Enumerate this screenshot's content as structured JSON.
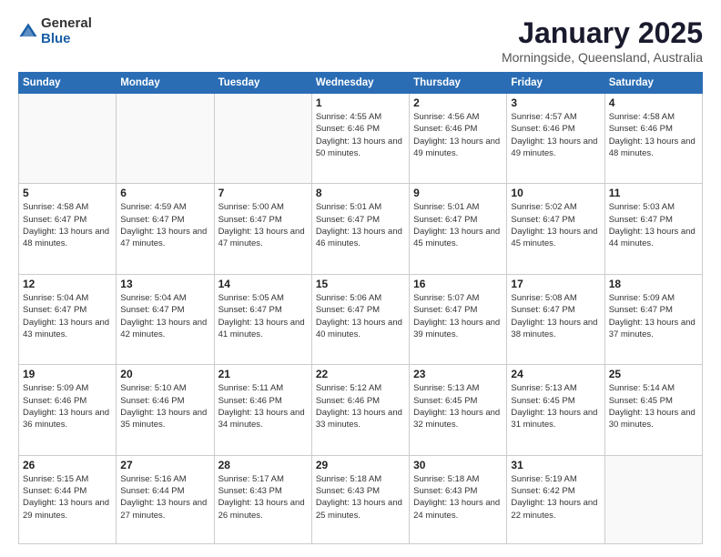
{
  "logo": {
    "general": "General",
    "blue": "Blue"
  },
  "title": "January 2025",
  "subtitle": "Morningside, Queensland, Australia",
  "days_of_week": [
    "Sunday",
    "Monday",
    "Tuesday",
    "Wednesday",
    "Thursday",
    "Friday",
    "Saturday"
  ],
  "weeks": [
    [
      {
        "day": "",
        "info": ""
      },
      {
        "day": "",
        "info": ""
      },
      {
        "day": "",
        "info": ""
      },
      {
        "day": "1",
        "info": "Sunrise: 4:55 AM\nSunset: 6:46 PM\nDaylight: 13 hours\nand 50 minutes."
      },
      {
        "day": "2",
        "info": "Sunrise: 4:56 AM\nSunset: 6:46 PM\nDaylight: 13 hours\nand 49 minutes."
      },
      {
        "day": "3",
        "info": "Sunrise: 4:57 AM\nSunset: 6:46 PM\nDaylight: 13 hours\nand 49 minutes."
      },
      {
        "day": "4",
        "info": "Sunrise: 4:58 AM\nSunset: 6:46 PM\nDaylight: 13 hours\nand 48 minutes."
      }
    ],
    [
      {
        "day": "5",
        "info": "Sunrise: 4:58 AM\nSunset: 6:47 PM\nDaylight: 13 hours\nand 48 minutes."
      },
      {
        "day": "6",
        "info": "Sunrise: 4:59 AM\nSunset: 6:47 PM\nDaylight: 13 hours\nand 47 minutes."
      },
      {
        "day": "7",
        "info": "Sunrise: 5:00 AM\nSunset: 6:47 PM\nDaylight: 13 hours\nand 47 minutes."
      },
      {
        "day": "8",
        "info": "Sunrise: 5:01 AM\nSunset: 6:47 PM\nDaylight: 13 hours\nand 46 minutes."
      },
      {
        "day": "9",
        "info": "Sunrise: 5:01 AM\nSunset: 6:47 PM\nDaylight: 13 hours\nand 45 minutes."
      },
      {
        "day": "10",
        "info": "Sunrise: 5:02 AM\nSunset: 6:47 PM\nDaylight: 13 hours\nand 45 minutes."
      },
      {
        "day": "11",
        "info": "Sunrise: 5:03 AM\nSunset: 6:47 PM\nDaylight: 13 hours\nand 44 minutes."
      }
    ],
    [
      {
        "day": "12",
        "info": "Sunrise: 5:04 AM\nSunset: 6:47 PM\nDaylight: 13 hours\nand 43 minutes."
      },
      {
        "day": "13",
        "info": "Sunrise: 5:04 AM\nSunset: 6:47 PM\nDaylight: 13 hours\nand 42 minutes."
      },
      {
        "day": "14",
        "info": "Sunrise: 5:05 AM\nSunset: 6:47 PM\nDaylight: 13 hours\nand 41 minutes."
      },
      {
        "day": "15",
        "info": "Sunrise: 5:06 AM\nSunset: 6:47 PM\nDaylight: 13 hours\nand 40 minutes."
      },
      {
        "day": "16",
        "info": "Sunrise: 5:07 AM\nSunset: 6:47 PM\nDaylight: 13 hours\nand 39 minutes."
      },
      {
        "day": "17",
        "info": "Sunrise: 5:08 AM\nSunset: 6:47 PM\nDaylight: 13 hours\nand 38 minutes."
      },
      {
        "day": "18",
        "info": "Sunrise: 5:09 AM\nSunset: 6:47 PM\nDaylight: 13 hours\nand 37 minutes."
      }
    ],
    [
      {
        "day": "19",
        "info": "Sunrise: 5:09 AM\nSunset: 6:46 PM\nDaylight: 13 hours\nand 36 minutes."
      },
      {
        "day": "20",
        "info": "Sunrise: 5:10 AM\nSunset: 6:46 PM\nDaylight: 13 hours\nand 35 minutes."
      },
      {
        "day": "21",
        "info": "Sunrise: 5:11 AM\nSunset: 6:46 PM\nDaylight: 13 hours\nand 34 minutes."
      },
      {
        "day": "22",
        "info": "Sunrise: 5:12 AM\nSunset: 6:46 PM\nDaylight: 13 hours\nand 33 minutes."
      },
      {
        "day": "23",
        "info": "Sunrise: 5:13 AM\nSunset: 6:45 PM\nDaylight: 13 hours\nand 32 minutes."
      },
      {
        "day": "24",
        "info": "Sunrise: 5:13 AM\nSunset: 6:45 PM\nDaylight: 13 hours\nand 31 minutes."
      },
      {
        "day": "25",
        "info": "Sunrise: 5:14 AM\nSunset: 6:45 PM\nDaylight: 13 hours\nand 30 minutes."
      }
    ],
    [
      {
        "day": "26",
        "info": "Sunrise: 5:15 AM\nSunset: 6:44 PM\nDaylight: 13 hours\nand 29 minutes."
      },
      {
        "day": "27",
        "info": "Sunrise: 5:16 AM\nSunset: 6:44 PM\nDaylight: 13 hours\nand 27 minutes."
      },
      {
        "day": "28",
        "info": "Sunrise: 5:17 AM\nSunset: 6:43 PM\nDaylight: 13 hours\nand 26 minutes."
      },
      {
        "day": "29",
        "info": "Sunrise: 5:18 AM\nSunset: 6:43 PM\nDaylight: 13 hours\nand 25 minutes."
      },
      {
        "day": "30",
        "info": "Sunrise: 5:18 AM\nSunset: 6:43 PM\nDaylight: 13 hours\nand 24 minutes."
      },
      {
        "day": "31",
        "info": "Sunrise: 5:19 AM\nSunset: 6:42 PM\nDaylight: 13 hours\nand 22 minutes."
      },
      {
        "day": "",
        "info": ""
      }
    ]
  ]
}
